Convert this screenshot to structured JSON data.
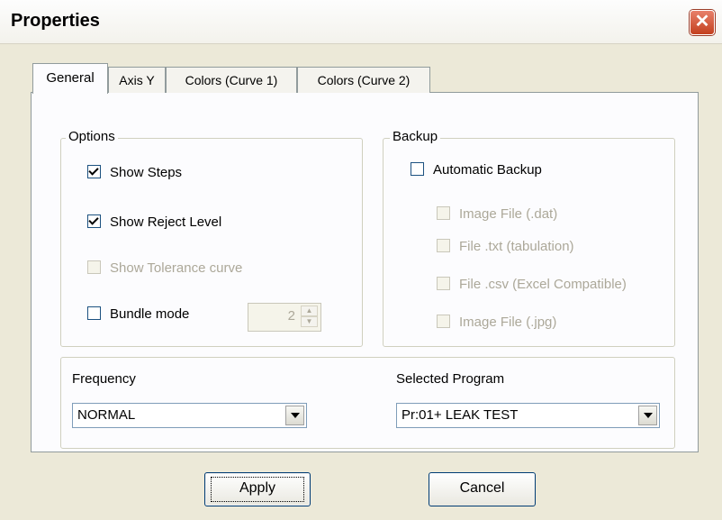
{
  "window": {
    "title": "Properties",
    "close_glyph": "✕"
  },
  "tabs": [
    {
      "label": "General",
      "active": true
    },
    {
      "label": "Axis Y",
      "active": false
    },
    {
      "label": "Colors (Curve 1)",
      "active": false
    },
    {
      "label": "Colors (Curve 2)",
      "active": false
    }
  ],
  "options": {
    "legend": "Options",
    "show_steps": {
      "label": "Show Steps",
      "checked": true,
      "enabled": true
    },
    "show_reject_level": {
      "label": "Show Reject Level",
      "checked": true,
      "enabled": true
    },
    "show_tolerance_curve": {
      "label": "Show Tolerance curve",
      "checked": false,
      "enabled": false
    },
    "bundle_mode": {
      "label": "Bundle mode",
      "checked": false,
      "enabled": true,
      "value": "2"
    }
  },
  "backup": {
    "legend": "Backup",
    "automatic_backup": {
      "label": "Automatic Backup",
      "checked": false,
      "enabled": true
    },
    "image_file_dat": {
      "label": "Image File (.dat)",
      "checked": false,
      "enabled": false
    },
    "file_txt": {
      "label": "File .txt (tabulation)",
      "checked": false,
      "enabled": false
    },
    "file_csv": {
      "label": "File .csv (Excel Compatible)",
      "checked": false,
      "enabled": false
    },
    "image_file_jpg": {
      "label": "Image File  (.jpg)",
      "checked": false,
      "enabled": false
    }
  },
  "frequency": {
    "label": "Frequency",
    "value": "NORMAL"
  },
  "selected_program": {
    "label": "Selected Program",
    "value": "Pr:01+ LEAK TEST"
  },
  "buttons": {
    "apply": "Apply",
    "cancel": "Cancel"
  },
  "icons": {
    "close": "close-icon",
    "dropdown": "chevron-down-icon",
    "spin_up": "spin-up-icon",
    "spin_down": "spin-down-icon"
  }
}
